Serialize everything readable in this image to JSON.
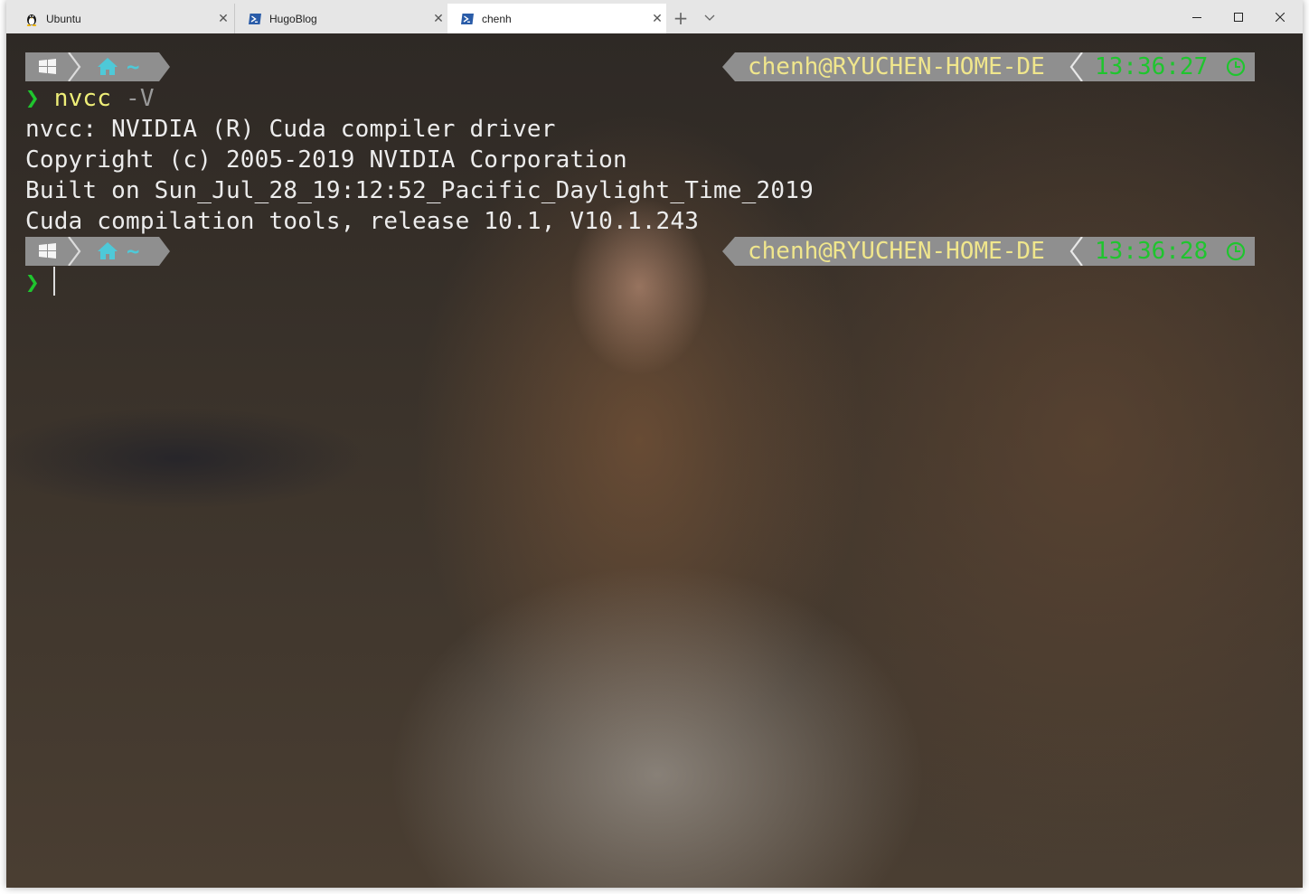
{
  "tabs": [
    {
      "label": "Ubuntu",
      "icon": "linux-penguin-icon",
      "active": false
    },
    {
      "label": "HugoBlog",
      "icon": "powershell-icon",
      "active": false
    },
    {
      "label": "chenh",
      "icon": "powershell-icon",
      "active": true
    }
  ],
  "tabbar": {
    "new_tab": "+",
    "close_glyph": "✕"
  },
  "prompts": [
    {
      "dir": "~",
      "user_host": "chenh@RYUCHEN-HOME-DE",
      "time": "13:36:27"
    },
    {
      "dir": "~",
      "user_host": "chenh@RYUCHEN-HOME-DE",
      "time": "13:36:28"
    }
  ],
  "terminal": {
    "prompt_char": "❯",
    "command": {
      "name": "nvcc",
      "args": " -V"
    },
    "output": [
      "nvcc: NVIDIA (R) Cuda compiler driver",
      "Copyright (c) 2005-2019 NVIDIA Corporation",
      "Built on Sun_Jul_28_19:12:52_Pacific_Daylight_Time_2019",
      "Cuda compilation tools, release 10.1, V10.1.243"
    ]
  },
  "colors": {
    "prompt_green": "#1fc52e",
    "command_yellow": "#eeee78",
    "segment_gray": "#8f8f8f",
    "home_cyan": "#4ec9d8",
    "user_host_yellow": "#f0e68c"
  }
}
